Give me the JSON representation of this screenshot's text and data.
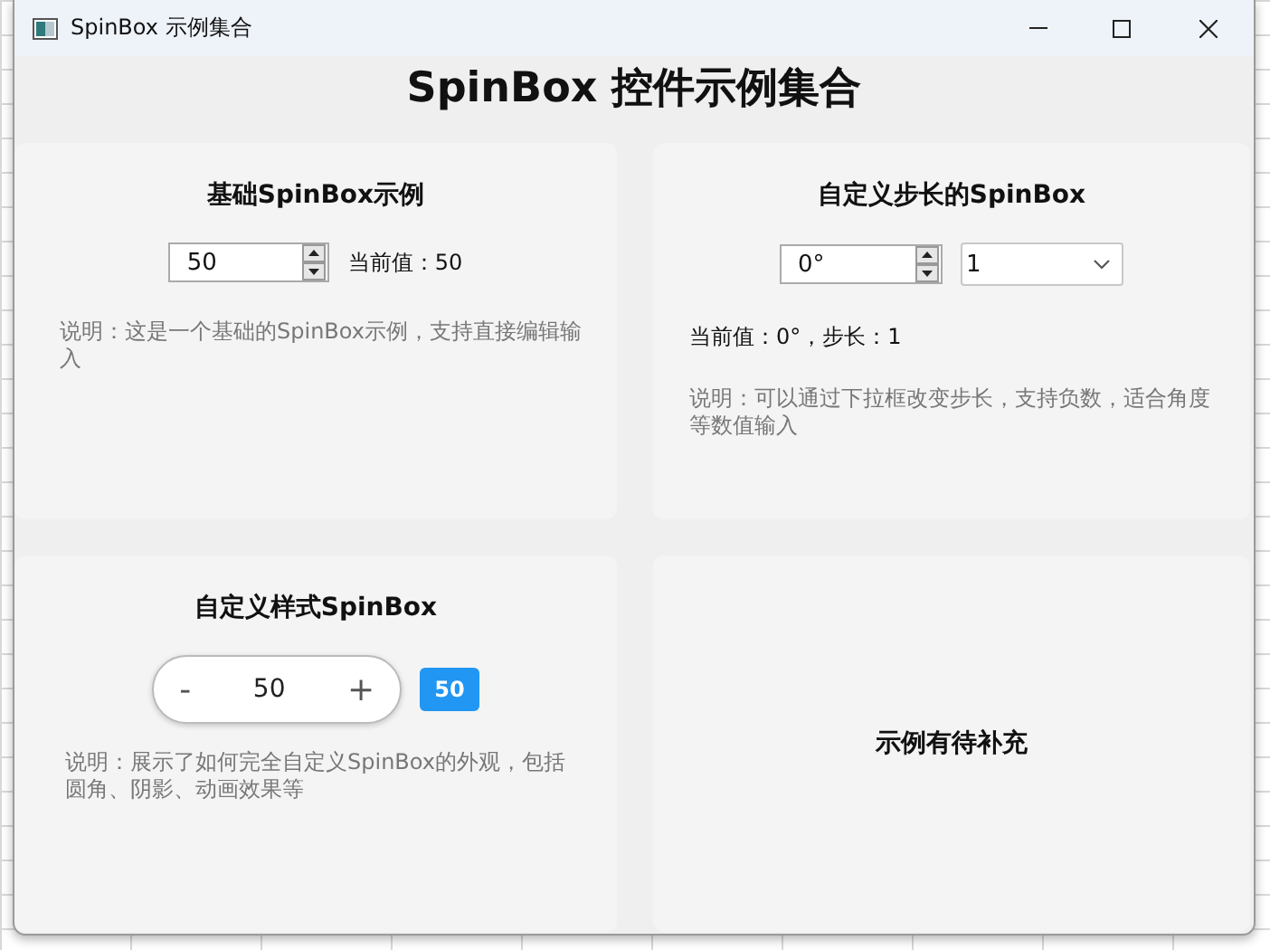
{
  "window": {
    "title": "SpinBox 示例集合"
  },
  "heading": "SpinBox 控件示例集合",
  "cards": [
    {
      "kind": "basic",
      "title": "基础SpinBox示例",
      "spinbox": {
        "value": "50"
      },
      "reading": "当前值：50",
      "note": "说明：这是一个基础的SpinBox示例，支持直接编辑输入"
    },
    {
      "kind": "step",
      "title": "自定义步长的SpinBox",
      "spinbox": {
        "value": "0°"
      },
      "dropdown": {
        "value": "1"
      },
      "reading": "当前值：0°，步长：1",
      "note": "说明：可以通过下拉框改变步长，支持负数，适合角度等数值输入"
    },
    {
      "kind": "styled",
      "title": "自定义样式SpinBox",
      "minus": "-",
      "value": "50",
      "plus": "+",
      "badge": "50",
      "note": "说明：展示了如何完全自定义SpinBox的外观，包括圆角、阴影、动画效果等"
    },
    {
      "kind": "placeholder",
      "title": "示例有待补充"
    }
  ]
}
